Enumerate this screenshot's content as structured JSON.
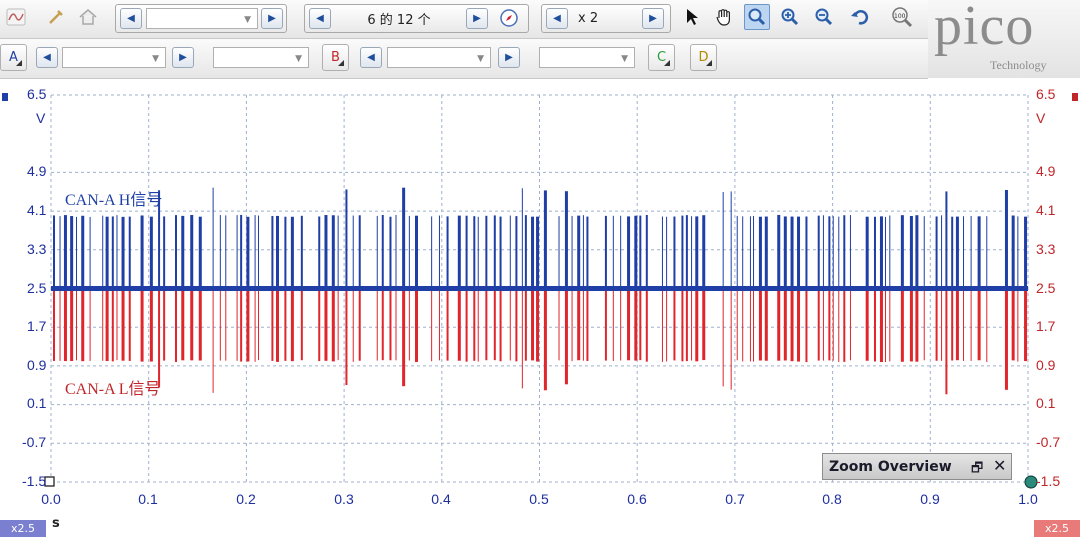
{
  "toolbar": {
    "page_position": "6 的 12 个",
    "zoom_factor": "x 2"
  },
  "channels": {
    "a_label": "A",
    "b_label": "B",
    "c_label": "C",
    "d_label": "D"
  },
  "brand": {
    "logo_text": "pico",
    "sub_text": "Technology"
  },
  "left_axis": {
    "unit": "V",
    "ticks": [
      "6.5",
      "4.9",
      "4.1",
      "3.3",
      "2.5",
      "1.7",
      "0.9",
      "0.1",
      "-0.7",
      "-1.5"
    ]
  },
  "right_axis": {
    "unit": "V",
    "ticks": [
      "6.5",
      "4.9",
      "4.1",
      "3.3",
      "2.5",
      "1.7",
      "0.9",
      "0.1",
      "-0.7",
      "-1.5"
    ]
  },
  "x_axis": {
    "unit": "s",
    "ticks": [
      "0.0",
      "0.1",
      "0.2",
      "0.3",
      "0.4",
      "0.5",
      "0.6",
      "0.7",
      "0.8",
      "0.9",
      "1.0"
    ],
    "left_scale": "x2.5",
    "right_scale": "x2.5"
  },
  "traces": {
    "h_label": "CAN-A H信号",
    "l_label": "CAN-A L信号",
    "h_color": "#1f3fa6",
    "l_color": "#e0262b",
    "h_recessive": 2.5,
    "h_dominant": 4.0,
    "l_dominant": 1.0
  },
  "zoom_overview": {
    "title": "Zoom Overview"
  }
}
